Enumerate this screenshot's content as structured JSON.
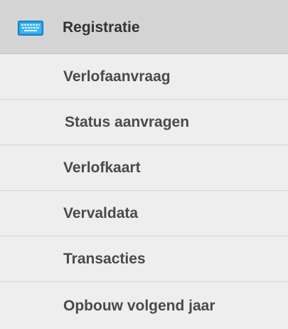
{
  "menu": {
    "header": {
      "label": "Registratie",
      "icon": "keyboard-icon",
      "icon_color": "#1a9be0"
    },
    "items": [
      {
        "label": "Verlofaanvraag"
      },
      {
        "label": "Status aanvragen"
      },
      {
        "label": "Verlofkaart"
      },
      {
        "label": "Vervaldata"
      },
      {
        "label": "Transacties"
      },
      {
        "label": "Opbouw volgend jaar"
      }
    ]
  }
}
